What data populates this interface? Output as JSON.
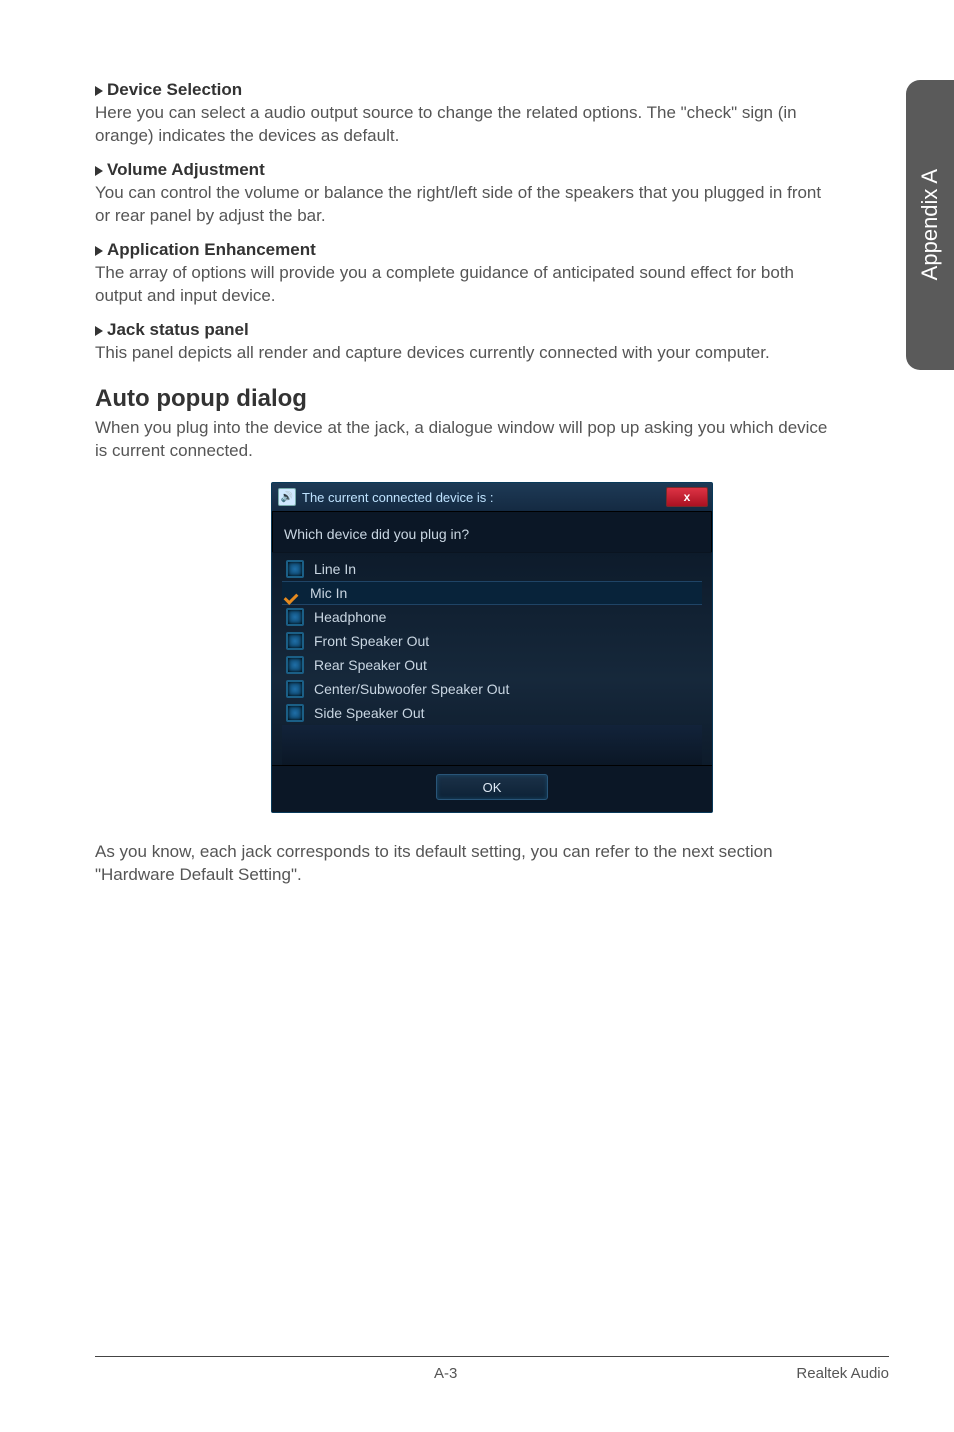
{
  "side_tab": "Appendix A",
  "sections": {
    "device_selection": {
      "title": "Device Selection",
      "body": "Here you can select a audio output source to change the related options. The \"check\" sign (in orange) indicates the devices as default."
    },
    "volume_adjustment": {
      "title": "Volume Adjustment",
      "body": "You can control the volume or balance the right/left side of the speakers that you plugged in front or rear panel by adjust the bar."
    },
    "application_enhancement": {
      "title": "Application Enhancement",
      "body": "The array of options will provide you a complete guidance of anticipated sound effect for both output and input device."
    },
    "jack_status_panel": {
      "title": "Jack status panel",
      "body": "This panel depicts all render and capture devices currently connected with your computer."
    }
  },
  "auto_popup": {
    "heading": "Auto popup dialog",
    "intro": "When you plug into the device at the jack, a dialogue window will pop up asking you which device is current connected."
  },
  "dialog": {
    "title": "The current connected device is :",
    "prompt": "Which device did you plug in?",
    "items": [
      {
        "label": "Line In",
        "checked": false
      },
      {
        "label": "Mic In",
        "checked": true
      },
      {
        "label": "Headphone",
        "checked": false
      },
      {
        "label": "Front Speaker Out",
        "checked": false
      },
      {
        "label": "Rear Speaker Out",
        "checked": false
      },
      {
        "label": "Center/Subwoofer Speaker Out",
        "checked": false
      },
      {
        "label": "Side Speaker Out",
        "checked": false
      }
    ],
    "ok": "OK",
    "close": "x"
  },
  "closing_text": "As you know, each jack corresponds to its default setting, you can refer to the next section \"Hardware Default Setting\".",
  "footer": {
    "page": "A-3",
    "section": "Realtek Audio"
  }
}
